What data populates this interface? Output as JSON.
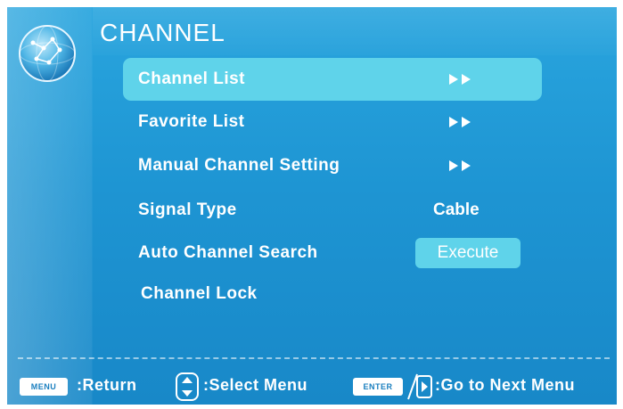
{
  "header": {
    "title": "CHANNEL",
    "logo_icon": "globe-constellation-icon"
  },
  "menu": {
    "items": [
      {
        "label": "Channel List",
        "value_type": "arrows",
        "selected": true
      },
      {
        "label": "Favorite List",
        "value_type": "arrows",
        "selected": false
      },
      {
        "label": "Manual Channel Setting",
        "value_type": "arrows",
        "selected": false
      },
      {
        "label": "Signal Type",
        "value_type": "text",
        "value": "Cable",
        "selected": false
      },
      {
        "label": "Auto Channel Search",
        "value_type": "button",
        "value": "Execute",
        "selected": false
      },
      {
        "label": "Channel Lock",
        "value_type": "none",
        "selected": false
      }
    ]
  },
  "footer": {
    "menu_key": "MENU",
    "return_label": ":Return",
    "updown_icon": "up-down-arrow-icon",
    "select_label": ":Select Menu",
    "enter_key": "ENTER",
    "right_icon": "right-arrow-icon",
    "next_label": ":Go to Next Menu"
  },
  "colors": {
    "background": "#1e95d3",
    "highlight": "#5fd3ea",
    "text": "#ffffff"
  }
}
